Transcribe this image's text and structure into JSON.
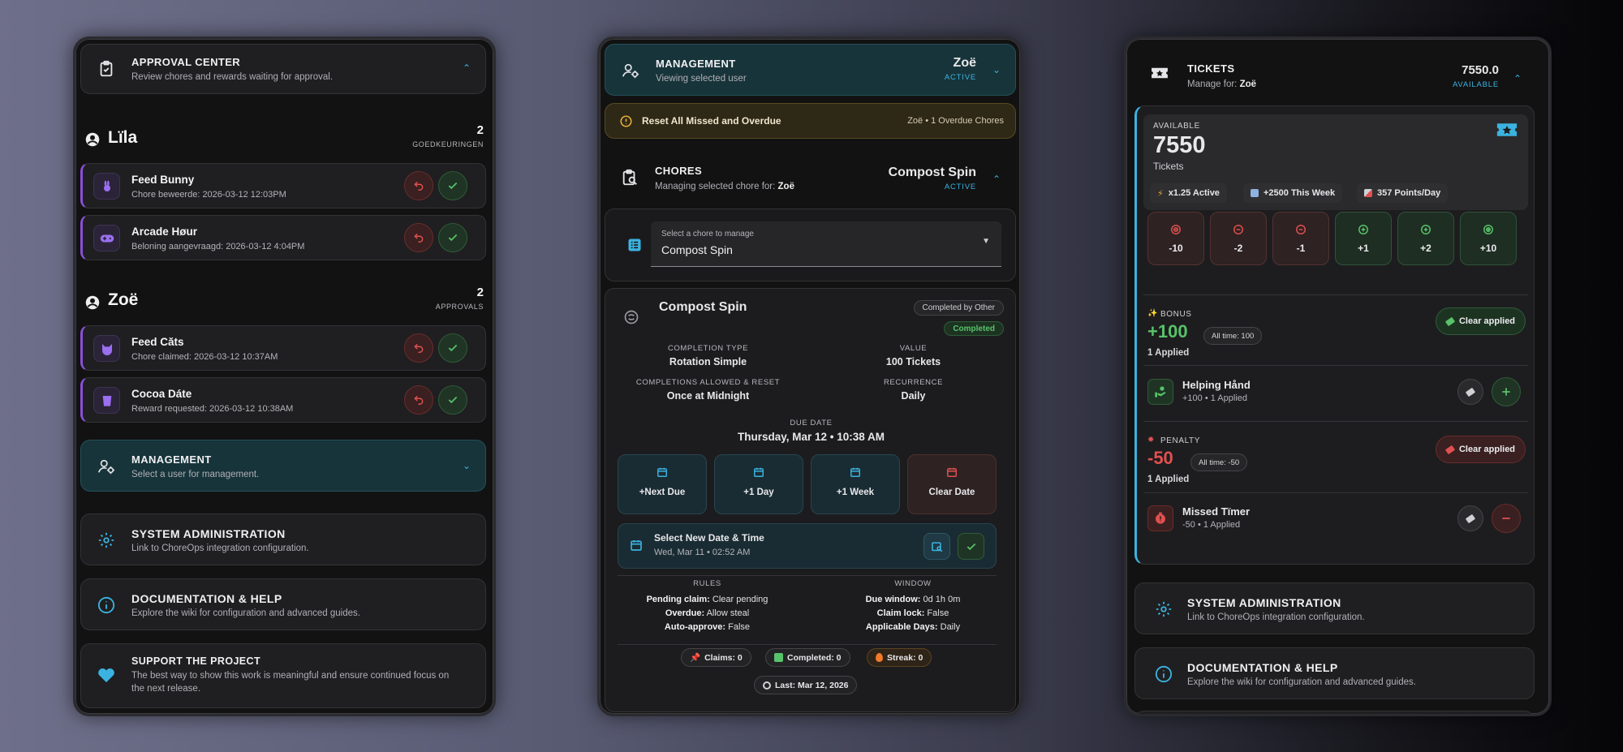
{
  "colors": {
    "accent": "#3bb3e0",
    "approve": "#58c26a",
    "reject": "#e05050",
    "chore_accent": "#8a4fd6"
  },
  "panel1": {
    "approval_center": {
      "title": "APPROVAL CENTER",
      "subtitle": "Review chores and rewards waiting for approval."
    },
    "users": [
      {
        "name": "Lïla",
        "count": "2",
        "count_label": "GOEDKEURINGEN",
        "items": [
          {
            "title": "Feed Bunny",
            "subtitle": "Chore beweerde: 2026-03-12 12:03PM",
            "icon": "rabbit-icon"
          },
          {
            "title": "Arcade Høur",
            "subtitle": "Beloning aangevraagd: 2026-03-12 4:04PM",
            "icon": "gamepad-icon"
          }
        ]
      },
      {
        "name": "Zoë",
        "count": "2",
        "count_label": "APPROVALS",
        "items": [
          {
            "title": "Feed Căts",
            "subtitle": "Chore claimed: 2026-03-12 10:37AM",
            "icon": "cat-icon"
          },
          {
            "title": "Cocoa Dáte",
            "subtitle": "Reward requested: 2026-03-12 10:38AM",
            "icon": "cup-icon"
          }
        ]
      }
    ],
    "management": {
      "title": "MANAGEMENT",
      "subtitle": "Select a user for management."
    },
    "system_admin": {
      "title": "SYSTEM ADMINISTRATION",
      "subtitle": "Link to ChoreOps integration configuration."
    },
    "docs": {
      "title": "DOCUMENTATION & HELP",
      "subtitle": "Explore the wiki for configuration and advanced guides."
    },
    "support": {
      "title": "SUPPORT THE PROJECT",
      "subtitle_line1": "The best way to show this work is meaningful and ensure continued focus on",
      "subtitle_line2": "the next release."
    }
  },
  "panel2": {
    "management": {
      "title": "MANAGEMENT",
      "subtitle": "Viewing selected user",
      "user": "Zoë",
      "status": "ACTIVE"
    },
    "reset_bar": {
      "label": "Reset All Missed and Overdue",
      "info": "Zoë • 1 Overdue Chores"
    },
    "chores": {
      "title": "CHORES",
      "subtitle_prefix": "Managing selected chore for: ",
      "subtitle_user": "Zoë",
      "chore": "Compost Spin",
      "status": "ACTIVE"
    },
    "select": {
      "label": "Select a chore to manage",
      "value": "Compost Spin"
    },
    "detail": {
      "name": "Compost Spin",
      "tag_top": "Completed by Other",
      "tag_status": "Completed",
      "completion_type_label": "COMPLETION TYPE",
      "completion_type": "Rotation Simple",
      "value_label": "VALUE",
      "value": "100 Tickets",
      "allowed_label": "COMPLETIONS ALLOWED & RESET",
      "allowed": "Once at Midnight",
      "recurrence_label": "RECURRENCE",
      "recurrence": "Daily",
      "due_label": "DUE DATE",
      "due": "Thursday, Mar 12 • 10:38 AM",
      "date_buttons": [
        "+Next Due",
        "+1 Day",
        "+1 Week",
        "Clear Date"
      ],
      "picker_title": "Select New Date & Time",
      "picker_value": "Wed, Mar 11 • 02:52 AM",
      "rules_label": "RULES",
      "window_label": "WINDOW",
      "rules": [
        {
          "k": "Pending claim:",
          "v": "Clear pending"
        },
        {
          "k": "Overdue:",
          "v": "Allow steal"
        },
        {
          "k": "Auto-approve:",
          "v": "False"
        }
      ],
      "window": [
        {
          "k": "Due window:",
          "v": "0d 1h 0m"
        },
        {
          "k": "Claim lock:",
          "v": "False"
        },
        {
          "k": "Applicable Days:",
          "v": "Daily"
        }
      ],
      "claims": "Claims: 0",
      "completed": "Completed: 0",
      "streak": "Streak: 0",
      "last": "Last: Mar 12, 2026"
    }
  },
  "panel3": {
    "tickets": {
      "title": "TICKETS",
      "subtitle_prefix": "Manage for: ",
      "subtitle_user": "Zoë",
      "amount": "7550.0",
      "amount_label": "AVAILABLE"
    },
    "balance": {
      "label": "AVAILABLE",
      "value": "7550",
      "unit": "Tickets"
    },
    "stats": [
      "x1.25 Active",
      "+2500 This Week",
      "357 Points/Day"
    ],
    "adjust": [
      "-10",
      "-2",
      "-1",
      "+1",
      "+2",
      "+10"
    ],
    "bonus": {
      "label": "BONUS",
      "value": "+100",
      "alltime": "All time: 100",
      "applied": "1 Applied",
      "clear": "Clear applied",
      "item": {
        "title": "Helping Hånd",
        "subtitle": "+100 • 1 Applied"
      }
    },
    "penalty": {
      "label": "PENALTY",
      "value": "-50",
      "alltime": "All time: -50",
      "applied": "1 Applied",
      "clear": "Clear applied",
      "item": {
        "title": "Missed Tïmer",
        "subtitle": "-50 • 1 Applied"
      }
    },
    "system_admin": {
      "title": "SYSTEM ADMINISTRATION",
      "subtitle": "Link to ChoreOps integration configuration."
    },
    "docs": {
      "title": "DOCUMENTATION & HELP",
      "subtitle": "Explore the wiki for configuration and advanced guides."
    }
  }
}
